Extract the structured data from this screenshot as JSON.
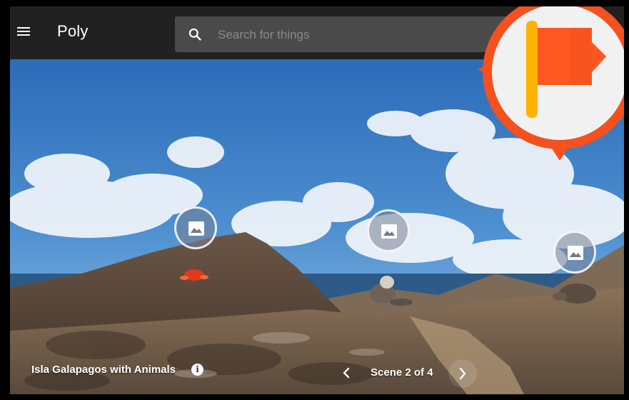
{
  "header": {
    "menu_icon": "menu-icon",
    "app_title": "Poly",
    "search": {
      "icon": "search-icon",
      "placeholder": "Search for things",
      "value": ""
    }
  },
  "scene": {
    "title": "Isla Galapagos with Animals",
    "info_icon": "info-icon",
    "info_glyph": "i",
    "counter": "Scene 2 of 4",
    "prev_icon": "chevron-left-icon",
    "next_icon": "chevron-right-icon",
    "hotspots": [
      {
        "name": "image-hotspot-left",
        "icon": "image-icon"
      },
      {
        "name": "image-hotspot-center",
        "icon": "image-icon"
      },
      {
        "name": "image-hotspot-right",
        "icon": "image-icon"
      }
    ]
  },
  "badge": {
    "icon": "flag-icon",
    "colors": {
      "ring": "#f4511e",
      "flag": "#ff5722",
      "pole": "#ffb300",
      "face": "#f1f1f1"
    }
  }
}
